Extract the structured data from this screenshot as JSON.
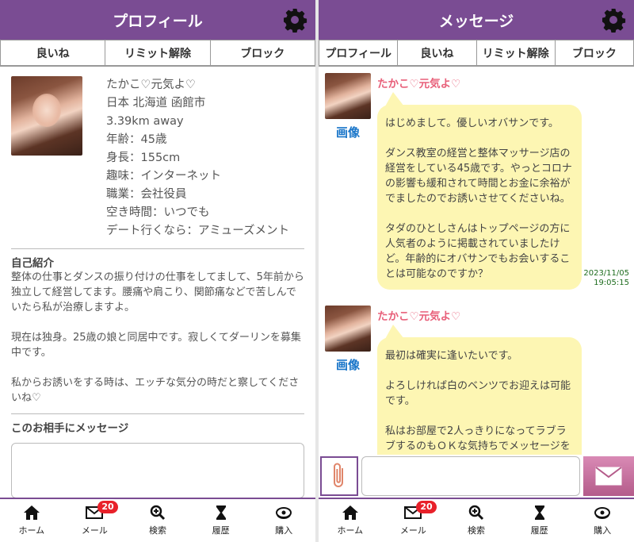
{
  "left": {
    "header": {
      "title": "プロフィール"
    },
    "tabs": [
      "良いね",
      "リミット解除",
      "ブロック"
    ],
    "profile": {
      "name": "たかこ♡元気よ♡",
      "location": "日本 北海道 函館市",
      "distance": "3.39km away",
      "age": "年齢：45歳",
      "height": "身長：155cm",
      "hobby": "趣味：インターネット",
      "job": "職業：会社役員",
      "free_time": "空き時間：いつでも",
      "date": "デート行くなら：アミューズメント"
    },
    "intro": {
      "title": "自己紹介",
      "text": "整体の仕事とダンスの振り付けの仕事をしてまして、5年前から独立して経営してます。腰痛や肩こり、関節痛などで苦しんでいたら私が治療しますよ。\n\n現在は独身。25歳の娘と同居中です。寂しくてダーリンを募集中です。\n\n私からお誘いをする時は、エッチな気分の時だと察してくださいね♡"
    },
    "message_section": {
      "title": "このお相手にメッセージ"
    }
  },
  "right": {
    "header": {
      "title": "メッセージ"
    },
    "tabs": [
      "プロフィール",
      "良いね",
      "リミット解除",
      "ブロック"
    ],
    "messages": [
      {
        "sender": "たかこ♡元気よ♡",
        "image_link": "画像",
        "text": "はじめまして。優しいオバサンです。\n\nダンス教室の経営と整体マッサージ店の経営をしている45歳です。やっとコロナの影響も緩和されて時間とお金に余裕がでましたのでお誘いさせてくださいね。\n\nタダのひとしさんはトップページの方に人気者のように掲載されていましたけど。年齢的にオバサンでもお会いすることは可能なのですか？",
        "date": "2023/11/05",
        "time": "19:05:15"
      },
      {
        "sender": "たかこ♡元気よ♡",
        "image_link": "画像",
        "text": "最初は確実に逢いたいです。\n\nよろしければ白のベンツでお迎えは可能です。\n\n私はお部屋で2人っきりになってラブラブするのもＯＫな気持ちでメッセージを書いています。近日ごゆっくり出"
      }
    ]
  },
  "nav": {
    "items": [
      {
        "label": "ホーム",
        "icon": "home-icon"
      },
      {
        "label": "メール",
        "icon": "mail-icon",
        "badge": "20"
      },
      {
        "label": "検索",
        "icon": "search-icon"
      },
      {
        "label": "履歴",
        "icon": "hourglass-icon"
      },
      {
        "label": "購入",
        "icon": "coin-icon"
      }
    ]
  },
  "colors": {
    "header": "#7a4c93",
    "bubble": "#fdf6b3",
    "sender": "#e8607a",
    "link": "#1a76c9",
    "badge": "#e8212a"
  }
}
